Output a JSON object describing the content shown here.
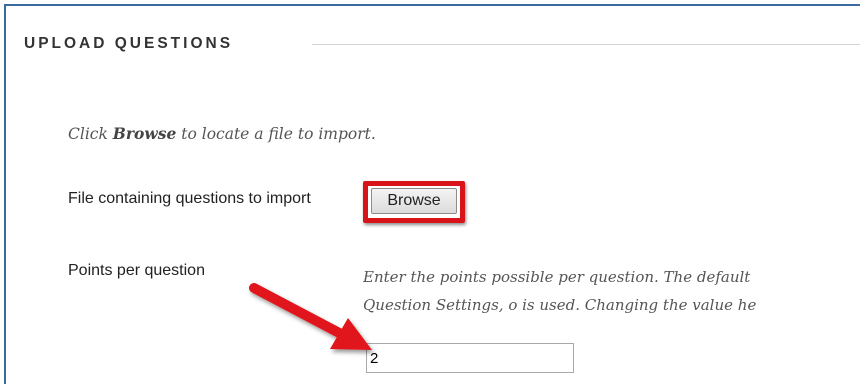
{
  "section": {
    "title": "UPLOAD QUESTIONS"
  },
  "instructions": {
    "prefix": "Click ",
    "bold": "Browse",
    "suffix": " to locate a file to import."
  },
  "file_field": {
    "label": "File containing questions to import",
    "button_label": "Browse"
  },
  "points_field": {
    "label": "Points per question",
    "help_line1": "Enter the points possible per question. The default",
    "help_line2": "Question Settings, o is used. Changing the value he",
    "value": "2"
  },
  "colors": {
    "highlight": "#d8141a",
    "arrow": "#e0141a",
    "frame_border": "#3a6aa0"
  },
  "icons": {
    "annotation_arrow": "arrow-icon"
  }
}
